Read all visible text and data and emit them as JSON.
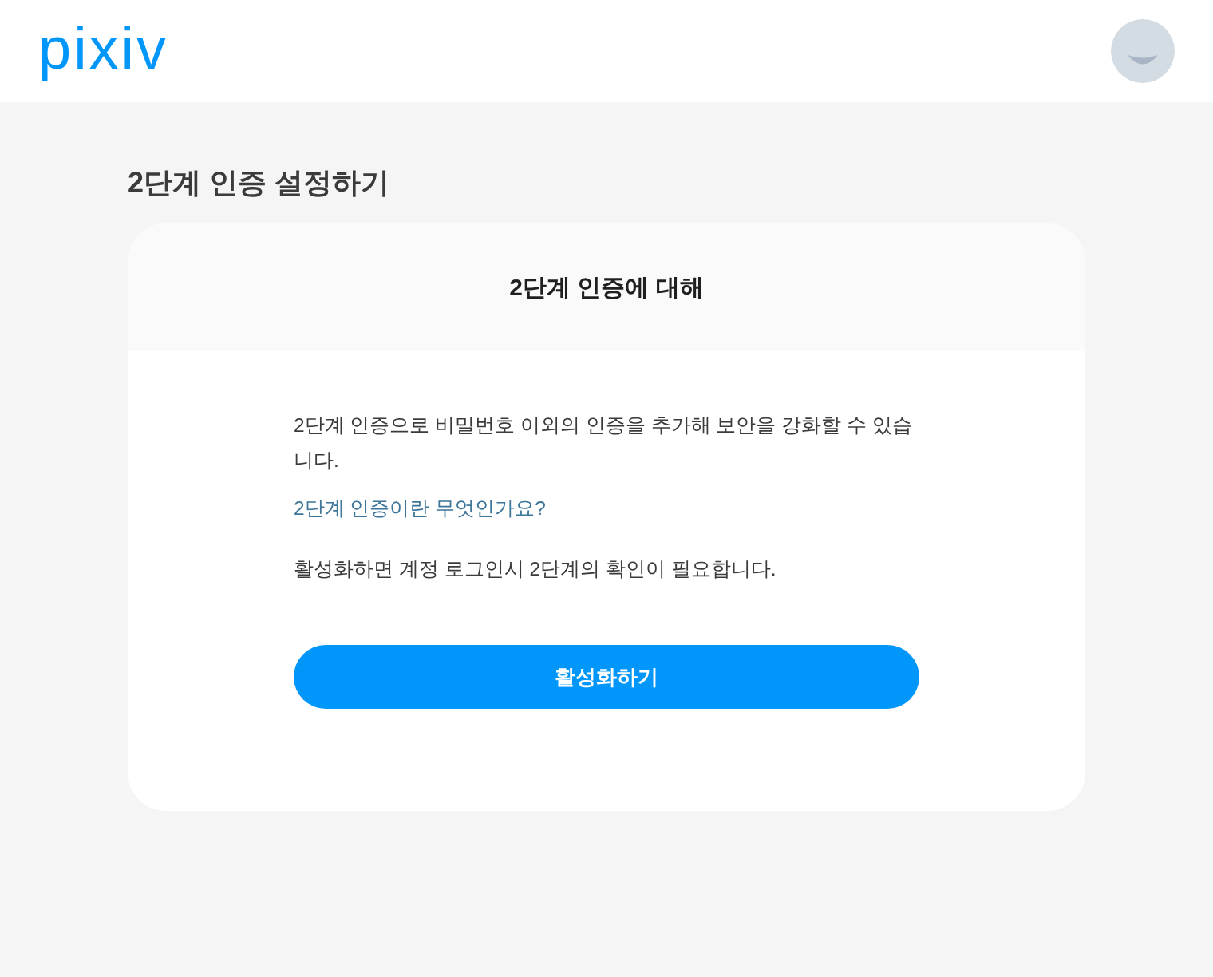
{
  "header": {
    "logo": "pixiv"
  },
  "page": {
    "title": "2단계 인증 설정하기"
  },
  "card": {
    "heading": "2단계 인증에 대해",
    "description": "2단계 인증으로 비밀번호 이외의 인증을 추가해 보안을 강화할 수 있습니다.",
    "help_link": "2단계 인증이란 무엇인가요?",
    "note": "활성화하면 계정 로그인시 2단계의 확인이 필요합니다.",
    "button": "활성화하기"
  }
}
